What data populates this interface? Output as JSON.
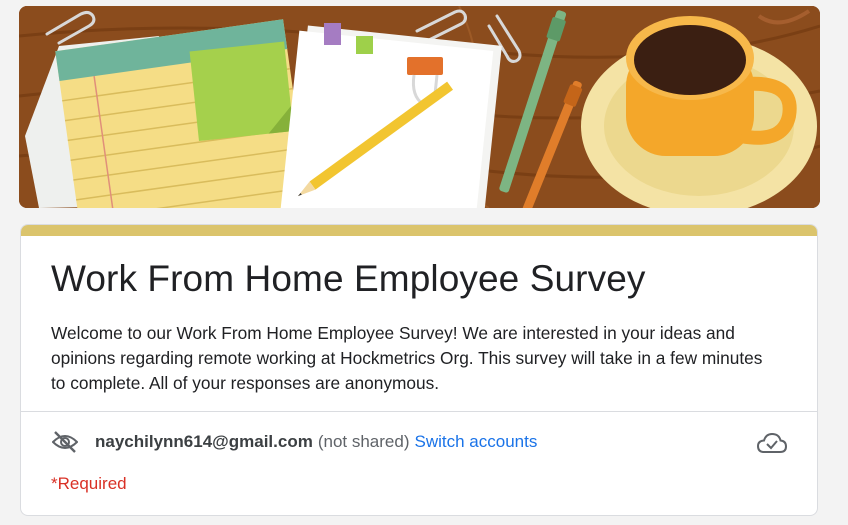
{
  "form": {
    "title": "Work From Home Employee Survey",
    "description": "Welcome to our Work From Home Employee Survey!  We are interested in your ideas and opinions regarding remote working at Hockmetrics Org. This survey will take in a few minutes to complete. All of your responses are anonymous.",
    "accent_color": "#dbc46c"
  },
  "account": {
    "email": "naychilynn614@gmail.com",
    "shared_status": "(not shared)",
    "switch_label": "Switch accounts",
    "visibility_icon": "eye-off-icon",
    "sync_icon": "cloud-check-icon"
  },
  "required_note": "*Required",
  "colors": {
    "link": "#1a73e8",
    "required": "#d93025",
    "page_background": "#f3f3f3"
  }
}
